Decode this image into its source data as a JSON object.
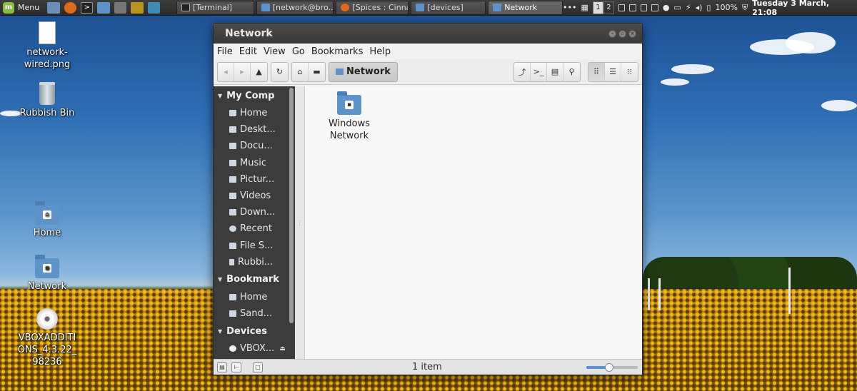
{
  "panel": {
    "menu_label": "Menu",
    "tasks": [
      {
        "label": "[Terminal]",
        "icon": "terminal-icon"
      },
      {
        "label": "[network@bro...",
        "icon": "folder-icon"
      },
      {
        "label": "[Spices : Cinna...",
        "icon": "firefox-icon"
      },
      {
        "label": "[devices]",
        "icon": "folder-icon"
      },
      {
        "label": "Network",
        "icon": "folder-icon"
      }
    ],
    "workspaces": [
      "1",
      "2"
    ],
    "battery": "100%",
    "clock": "Tuesday  3 March, 21:08"
  },
  "desktop": {
    "icons": [
      {
        "label": "network-wired.png",
        "icon": "image-file-icon"
      },
      {
        "label": "Rubbish Bin",
        "icon": "trash-icon"
      },
      {
        "label": "Home",
        "icon": "home-folder-icon"
      },
      {
        "label": "Network",
        "icon": "network-folder-icon"
      },
      {
        "label": "VBOXADDITIONS_4.3.22_98236",
        "icon": "cdrom-icon"
      }
    ]
  },
  "window": {
    "title": "Network",
    "menu": [
      "File",
      "Edit",
      "View",
      "Go",
      "Bookmarks",
      "Help"
    ],
    "location": "Network",
    "sidebar": {
      "sections": [
        {
          "title": "My Computer",
          "items": [
            "Home",
            "Desktop",
            "Documents",
            "Music",
            "Pictures",
            "Videos",
            "Downloads",
            "Recent",
            "File System",
            "Rubbish Bin"
          ]
        },
        {
          "title": "Bookmarks",
          "items": [
            "Home",
            "Sandbox"
          ]
        },
        {
          "title": "Devices",
          "items": [
            "VBOXADDITIONS"
          ]
        }
      ],
      "visible": {
        "my_computer": "My Comp",
        "items": [
          "Home",
          "Deskt...",
          "Docu...",
          "Music",
          "Pictur...",
          "Videos",
          "Down...",
          "Recent",
          "File S...",
          "Rubbi..."
        ],
        "bookmarks": "Bookmark",
        "bookmark_items": [
          "Home",
          "Sand..."
        ],
        "devices": "Devices",
        "device_items": [
          "VBOX..."
        ]
      }
    },
    "files": [
      {
        "label_line1": "Windows",
        "label_line2": "Network",
        "icon": "network-folder-icon"
      }
    ],
    "status": "1 item",
    "zoom_level": 0.45
  }
}
